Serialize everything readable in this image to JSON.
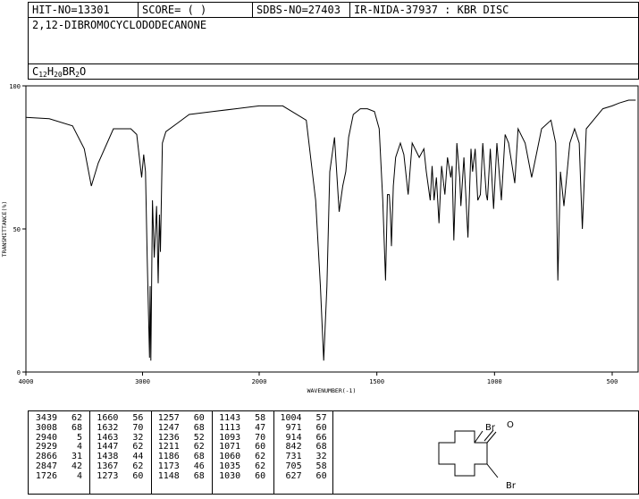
{
  "header": {
    "hit_no": "HIT-NO=13301",
    "score": "SCORE=  (   )",
    "sdbs_no": "SDBS-NO=27403",
    "ir_info": "IR-NIDA-37937 : KBR DISC",
    "compound_name": "2,12-DIBROMOCYCLODODECANONE",
    "formula": {
      "c": "C",
      "c_n": "12",
      "h": "H",
      "h_n": "20",
      "br": "BR",
      "br_n": "2",
      "o": "O"
    }
  },
  "chart_data": {
    "type": "line",
    "xlabel": "WAVENUMBER(-1)",
    "ylabel": "TRANSMITTANCE(%)",
    "xlim": [
      4000,
      400
    ],
    "ylim": [
      0,
      100
    ],
    "x_ticks": [
      "4000",
      "3000",
      "2000",
      "1500",
      "1000",
      "500"
    ],
    "y_ticks": [
      "100",
      "50",
      "0"
    ],
    "series": [
      {
        "x": [
          4000,
          3800,
          3600,
          3500,
          3439,
          3380,
          3250,
          3100,
          3050,
          3008,
          2990,
          2975,
          2960,
          2940,
          2935,
          2929,
          2915,
          2900,
          2880,
          2866,
          2855,
          2847,
          2830,
          2800,
          2700,
          2600,
          2400,
          2200,
          2000,
          1900,
          1800,
          1760,
          1740,
          1726,
          1712,
          1700,
          1680,
          1660,
          1645,
          1632,
          1620,
          1600,
          1570,
          1540,
          1510,
          1490,
          1475,
          1463,
          1455,
          1447,
          1442,
          1438,
          1430,
          1420,
          1400,
          1385,
          1367,
          1350,
          1320,
          1300,
          1290,
          1273,
          1265,
          1257,
          1247,
          1236,
          1225,
          1211,
          1200,
          1186,
          1180,
          1173,
          1160,
          1148,
          1143,
          1130,
          1113,
          1100,
          1093,
          1082,
          1071,
          1060,
          1050,
          1035,
          1030,
          1018,
          1004,
          990,
          971,
          955,
          940,
          914,
          900,
          870,
          842,
          800,
          760,
          740,
          731,
          720,
          705,
          680,
          660,
          640,
          627,
          610,
          580,
          540,
          500,
          470,
          430,
          400
        ],
        "y": [
          89,
          88.5,
          86,
          78,
          65,
          73,
          85,
          85,
          83,
          68,
          76,
          70,
          40,
          5,
          30,
          4,
          60,
          40,
          58,
          31,
          55,
          42,
          80,
          84,
          87,
          90,
          91,
          92,
          93,
          93,
          88,
          60,
          30,
          4,
          30,
          70,
          82,
          56,
          65,
          70,
          82,
          90,
          92,
          92,
          91,
          85,
          60,
          32,
          62,
          62,
          55,
          44,
          65,
          75,
          80,
          76,
          62,
          80,
          75,
          78,
          70,
          60,
          72,
          60,
          68,
          52,
          72,
          62,
          75,
          68,
          72,
          46,
          80,
          68,
          58,
          75,
          47,
          78,
          70,
          78,
          60,
          62,
          80,
          62,
          60,
          78,
          57,
          80,
          60,
          83,
          80,
          66,
          85,
          80,
          68,
          85,
          88,
          80,
          32,
          70,
          58,
          80,
          85,
          80,
          50,
          85,
          88,
          92,
          93,
          94,
          95,
          95
        ]
      }
    ]
  },
  "peak_table": [
    [
      [
        "3439",
        "62"
      ],
      [
        "3008",
        "68"
      ],
      [
        "2940",
        "5"
      ],
      [
        "2929",
        "4"
      ],
      [
        "2866",
        "31"
      ],
      [
        "2847",
        "42"
      ],
      [
        "1726",
        "4"
      ]
    ],
    [
      [
        "1660",
        "56"
      ],
      [
        "1632",
        "70"
      ],
      [
        "1463",
        "32"
      ],
      [
        "1447",
        "62"
      ],
      [
        "1438",
        "44"
      ],
      [
        "1367",
        "62"
      ],
      [
        "1273",
        "60"
      ]
    ],
    [
      [
        "1257",
        "60"
      ],
      [
        "1247",
        "68"
      ],
      [
        "1236",
        "52"
      ],
      [
        "1211",
        "62"
      ],
      [
        "1186",
        "68"
      ],
      [
        "1173",
        "46"
      ],
      [
        "1148",
        "68"
      ]
    ],
    [
      [
        "1143",
        "58"
      ],
      [
        "1113",
        "47"
      ],
      [
        "1093",
        "70"
      ],
      [
        "1071",
        "60"
      ],
      [
        "1060",
        "62"
      ],
      [
        "1035",
        "62"
      ],
      [
        "1030",
        "60"
      ]
    ],
    [
      [
        "1004",
        "57"
      ],
      [
        "971",
        "60"
      ],
      [
        "914",
        "66"
      ],
      [
        "842",
        "68"
      ],
      [
        "731",
        "32"
      ],
      [
        "705",
        "58"
      ],
      [
        "627",
        "60"
      ]
    ]
  ],
  "structure": {
    "labels": {
      "br_top": "Br",
      "o": "O",
      "br_bottom": "Br"
    }
  }
}
